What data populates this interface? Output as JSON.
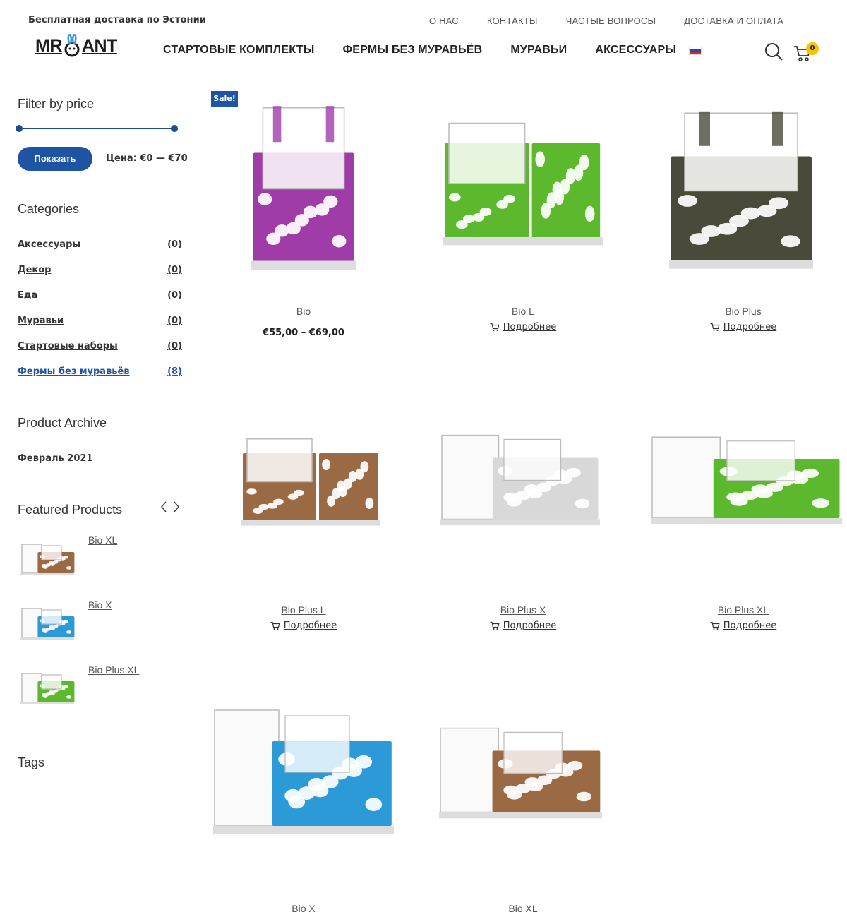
{
  "topbar": {
    "shipping_text": "Бесплатная доставка по Эстонии"
  },
  "toplinks": [
    "О НАС",
    "КОНТАКТЫ",
    "ЧАСТЫЕ ВОПРОСЫ",
    "ДОСТАВКА И ОПЛАТА"
  ],
  "logo": {
    "left": "MR",
    "right": "ANT"
  },
  "mainnav": [
    "СТАРТОВЫЕ КОМПЛЕКТЫ",
    "ФЕРМЫ БЕЗ МУРАВЬЁВ",
    "МУРАВЬИ",
    "АКСЕССУАРЫ"
  ],
  "cart": {
    "count": "0"
  },
  "filter": {
    "title": "Filter by price",
    "button": "Показать",
    "price_label": "Цена: €0 — €70"
  },
  "categories": {
    "title": "Categories",
    "items": [
      {
        "label": "Аксессуары",
        "count": "(0)"
      },
      {
        "label": "Декор",
        "count": "(0)"
      },
      {
        "label": "Еда",
        "count": "(0)"
      },
      {
        "label": "Муравьи",
        "count": "(0)"
      },
      {
        "label": "Стартовые наборы",
        "count": "(0)"
      },
      {
        "label": "Фермы без муравьёв",
        "count": "(8)"
      }
    ]
  },
  "archive": {
    "title": "Product Archive",
    "items": [
      "Февраль 2021"
    ]
  },
  "featured": {
    "title": "Featured Products",
    "items": [
      {
        "name": "Bio XL",
        "color": "#9a6a45"
      },
      {
        "name": "Bio X",
        "color": "#2d9ad8"
      },
      {
        "name": "Bio Plus XL",
        "color": "#5cb82d"
      }
    ]
  },
  "tags": {
    "title": "Tags"
  },
  "products": {
    "sale_badge": "Sale!",
    "more_label": "Подробнее",
    "items": [
      {
        "name": "Bio",
        "price": "€55,00 – €69,00",
        "color": "#a03ca8"
      },
      {
        "name": "Bio L",
        "color": "#5cb82d"
      },
      {
        "name": "Bio Plus",
        "color": "#4a4a3a"
      },
      {
        "name": "Bio Plus L",
        "color": "#9a6a45"
      },
      {
        "name": "Bio Plus X",
        "color": "#d8d8d8"
      },
      {
        "name": "Bio Plus XL",
        "color": "#5cb82d"
      },
      {
        "name": "Bio X",
        "color": "#2d9ad8"
      },
      {
        "name": "Bio XL",
        "color": "#9a6a45"
      }
    ]
  }
}
